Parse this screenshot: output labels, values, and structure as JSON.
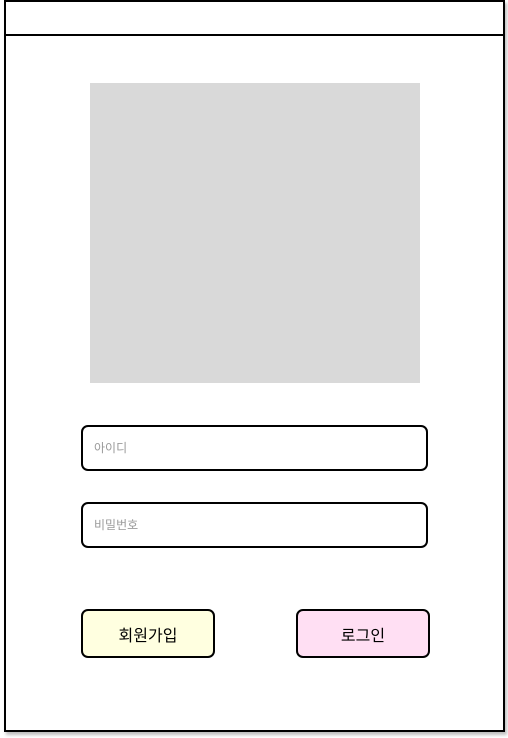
{
  "login_form": {
    "id_placeholder": "아이디",
    "password_placeholder": "비밀번호",
    "signup_label": "회원가입",
    "login_label": "로그인"
  },
  "colors": {
    "image_placeholder": "#d9d9d9",
    "signup_button_bg": "#ffffe0",
    "login_button_bg": "#ffdff3"
  }
}
